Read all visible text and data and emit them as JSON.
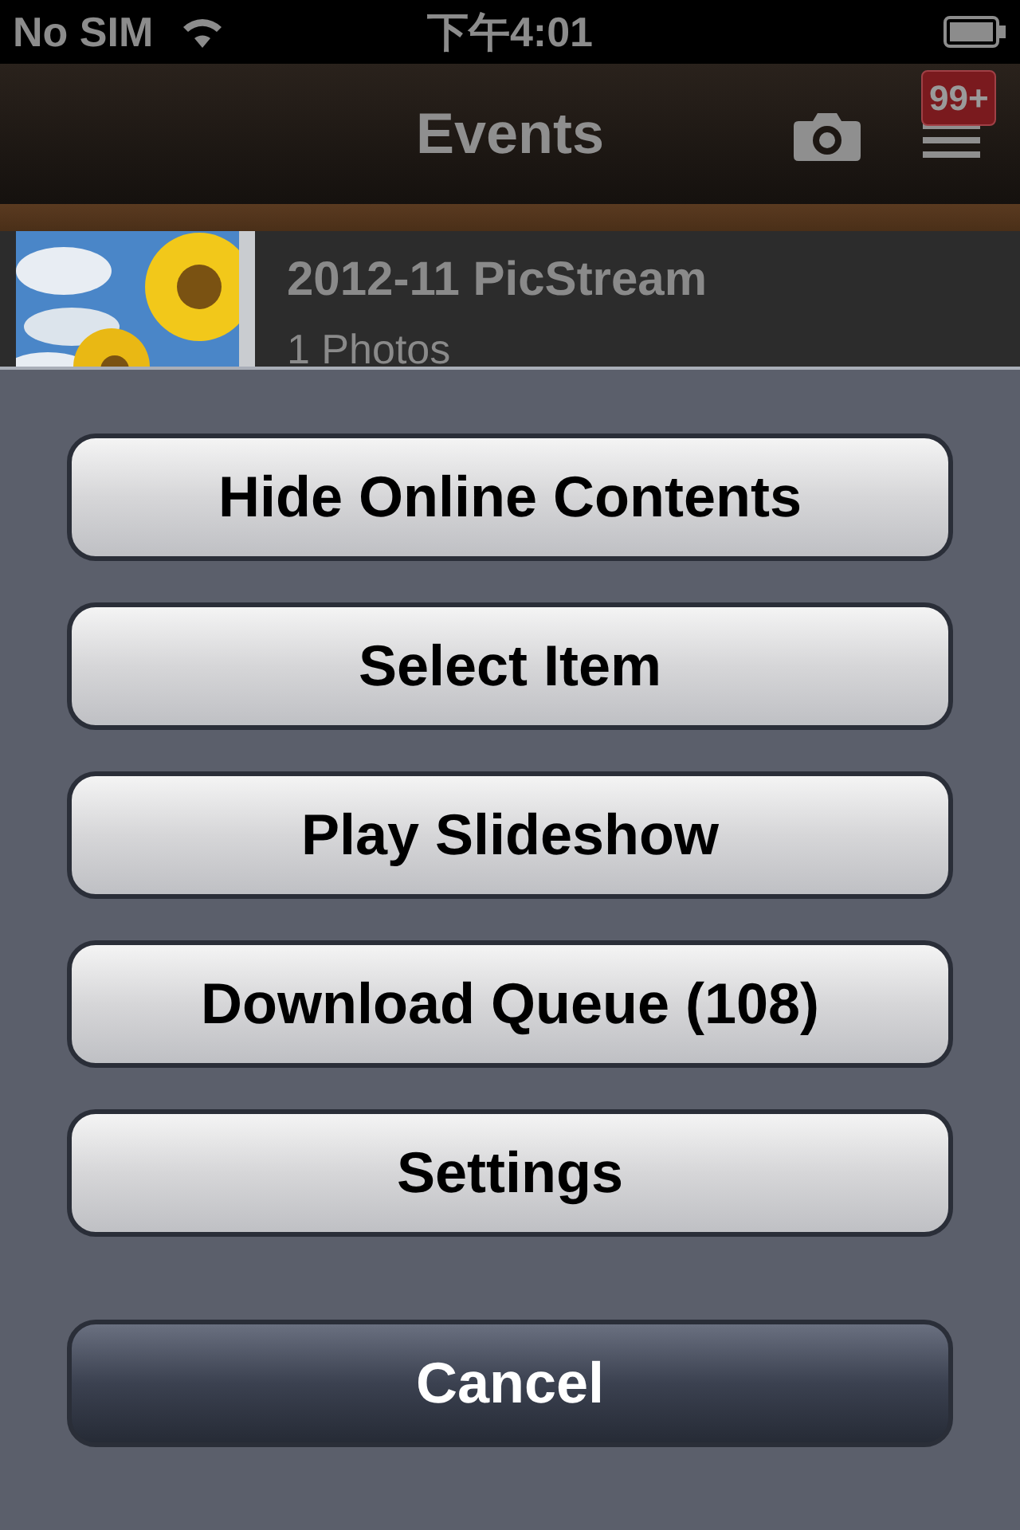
{
  "status_bar": {
    "carrier": "No SIM",
    "time": "下午4:01"
  },
  "nav_bar": {
    "title": "Events",
    "badge": "99+"
  },
  "events": [
    {
      "title": "2012-11 PicStream",
      "subtitle": "1 Photos"
    }
  ],
  "action_sheet": {
    "buttons": [
      {
        "label": "Hide Online Contents",
        "kind": "default"
      },
      {
        "label": "Select Item",
        "kind": "default"
      },
      {
        "label": "Play Slideshow",
        "kind": "default"
      },
      {
        "label": "Download Queue (108)",
        "kind": "default"
      },
      {
        "label": "Settings",
        "kind": "default"
      },
      {
        "label": "Cancel",
        "kind": "cancel"
      }
    ]
  }
}
